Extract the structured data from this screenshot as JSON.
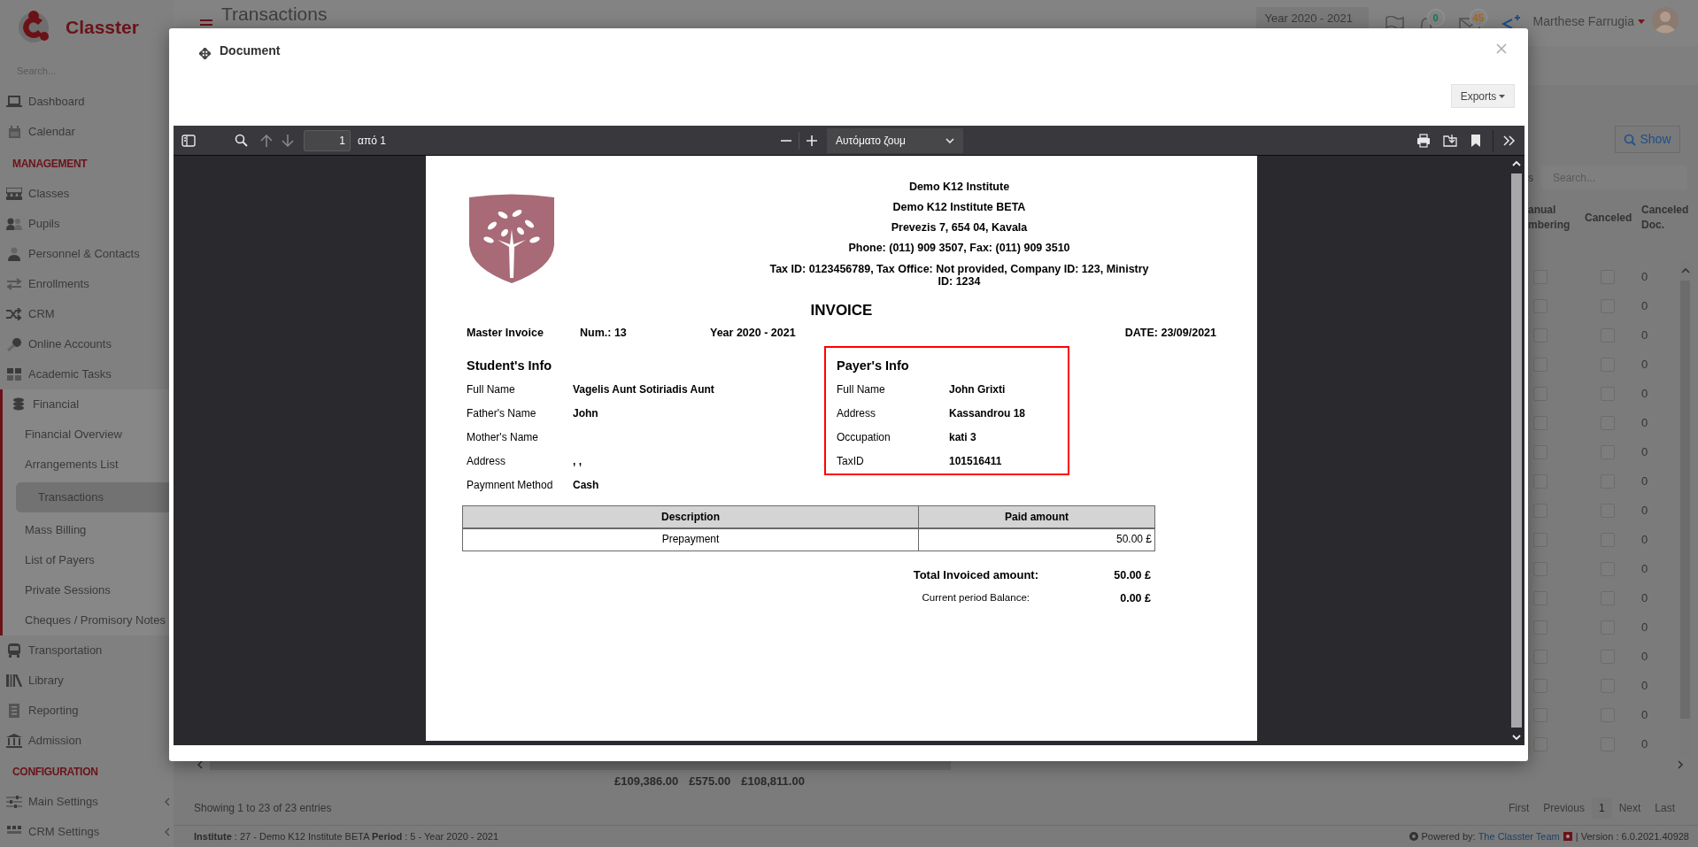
{
  "sidebar": {
    "logo": "Classter",
    "search_placeholder": "Search...",
    "items": [
      {
        "kind": "item",
        "label": "Dashboard",
        "selected": false
      },
      {
        "kind": "item",
        "label": "Calendar",
        "selected": false
      },
      {
        "kind": "section",
        "label": "MANAGEMENT"
      },
      {
        "kind": "item",
        "label": "Classes",
        "selected": false
      },
      {
        "kind": "item",
        "label": "Pupils",
        "selected": false
      },
      {
        "kind": "item",
        "label": "Personnel & Contacts",
        "selected": false
      },
      {
        "kind": "item",
        "label": "Enrollments",
        "selected": false
      },
      {
        "kind": "item",
        "label": "CRM",
        "selected": false
      },
      {
        "kind": "item",
        "label": "Online Accounts",
        "selected": false
      },
      {
        "kind": "item",
        "label": "Academic Tasks",
        "selected": false
      },
      {
        "kind": "item",
        "label": "Financial",
        "selected": false,
        "expanded": true,
        "children": [
          {
            "label": "Financial Overview",
            "selected": false
          },
          {
            "label": "Arrangements List",
            "selected": false
          },
          {
            "label": "Transactions",
            "selected": true
          },
          {
            "label": "Mass Billing",
            "selected": false
          },
          {
            "label": "List of Payers",
            "selected": false
          },
          {
            "label": "Private Sessions",
            "selected": false
          },
          {
            "label": "Cheques / Promisory Notes",
            "selected": false
          }
        ]
      },
      {
        "kind": "item",
        "label": "Transportation",
        "selected": false
      },
      {
        "kind": "item",
        "label": "Library",
        "selected": false
      },
      {
        "kind": "item",
        "label": "Reporting",
        "selected": false
      },
      {
        "kind": "item",
        "label": "Admission",
        "selected": false
      },
      {
        "kind": "section",
        "label": "CONFIGURATION"
      },
      {
        "kind": "item",
        "label": "Main Settings",
        "selected": false,
        "expanded": false
      },
      {
        "kind": "item",
        "label": "CRM Settings",
        "selected": false,
        "expanded": false
      }
    ]
  },
  "header": {
    "title": "Transactions",
    "year": "Year 2020 - 2021",
    "notifications": "0",
    "messages": "45",
    "user": "Marthese Farrugia"
  },
  "panel": {
    "show_button": "Show",
    "search_label": "s",
    "search_placeholder": "Search...",
    "columns": [
      "anual mbering",
      "Canceled",
      "Canceled Doc."
    ],
    "rows": [
      {
        "manual_numbering": false,
        "canceled": false,
        "canceled_doc": "0"
      },
      {
        "manual_numbering": false,
        "canceled": false,
        "canceled_doc": "0"
      },
      {
        "manual_numbering": false,
        "canceled": false,
        "canceled_doc": "0"
      },
      {
        "manual_numbering": false,
        "canceled": false,
        "canceled_doc": "0"
      },
      {
        "manual_numbering": false,
        "canceled": false,
        "canceled_doc": "0"
      },
      {
        "manual_numbering": false,
        "canceled": false,
        "canceled_doc": "0"
      },
      {
        "manual_numbering": false,
        "canceled": false,
        "canceled_doc": "0"
      },
      {
        "manual_numbering": false,
        "canceled": false,
        "canceled_doc": "0"
      },
      {
        "manual_numbering": false,
        "canceled": false,
        "canceled_doc": "0"
      },
      {
        "manual_numbering": false,
        "canceled": false,
        "canceled_doc": "0"
      },
      {
        "manual_numbering": false,
        "canceled": false,
        "canceled_doc": "0"
      },
      {
        "manual_numbering": false,
        "canceled": false,
        "canceled_doc": "0"
      },
      {
        "manual_numbering": false,
        "canceled": false,
        "canceled_doc": "0"
      },
      {
        "manual_numbering": false,
        "canceled": false,
        "canceled_doc": "0"
      },
      {
        "manual_numbering": false,
        "canceled": false,
        "canceled_doc": "0"
      },
      {
        "manual_numbering": false,
        "canceled": false,
        "canceled_doc": "0"
      },
      {
        "manual_numbering": false,
        "canceled": false,
        "canceled_doc": "0"
      }
    ],
    "totals": [
      "£109,386.00",
      "£575.00",
      "£108,811.00"
    ],
    "info": "Showing 1 to 23 of 23 entries",
    "pagination": [
      {
        "label": "First",
        "selected": false
      },
      {
        "label": "Previous",
        "selected": false
      },
      {
        "label": "1",
        "selected": true
      },
      {
        "label": "Next",
        "selected": false
      },
      {
        "label": "Last",
        "selected": false
      }
    ]
  },
  "status_bar": {
    "left": "**Institute** : 27 - Demo K12 Institute BETA **Period** : 5 - Year 2020 - 2021",
    "powered_by": "Powered by:",
    "team": "The Classter Team",
    "version": "| Version : 6.0.2021.40928"
  },
  "modal": {
    "title": "Document",
    "exports": "Exports",
    "viewer": {
      "page_number": "1",
      "page_count": "από 1",
      "zoom": "Αυτόματο ζουμ"
    },
    "invoice": {
      "institute_lines": [
        "Demo K12 Institute",
        "Demo K12 Institute BETA",
        "Prevezis 7, 654 04, Kavala",
        "Phone: (011) 909 3507, Fax: (011) 909 3510",
        "Tax ID: 0123456789, Tax Office: Not provided, Company ID: 123, Ministry ID: 1234"
      ],
      "title": "INVOICE",
      "meta": [
        "Master Invoice",
        "Num.: 13",
        "Year 2020 - 2021",
        "DATE: 23/09/2021"
      ],
      "student": {
        "heading": "Student's Info",
        "rows": [
          {
            "label": "Full Name",
            "value": "Vagelis Aunt Sotiriadis Aunt"
          },
          {
            "label": "Father's Name",
            "value": "John"
          },
          {
            "label": "Mother's Name"
          },
          {
            "label": "Address",
            "value": ", ,"
          },
          {
            "label": "Paymnent Method",
            "value": "Cash"
          }
        ]
      },
      "payer": {
        "heading": "Payer's Info",
        "highlighted": true,
        "rows": [
          {
            "label": "Full Name",
            "value": "John Grixti"
          },
          {
            "label": "Address",
            "value": "Kassandrou 18"
          },
          {
            "label": "Occupation",
            "value": "kati 3"
          },
          {
            "label": "TaxID",
            "value": "101516411"
          }
        ]
      },
      "table": {
        "columns": [
          "Description",
          "Paid amount"
        ],
        "rows": [
          [
            "Prepayment",
            "50.00 £"
          ]
        ]
      },
      "totals": [
        {
          "kind": "bold",
          "label": "Total Invoiced amount:",
          "value": "50.00 £"
        },
        {
          "kind": "plain",
          "label": "Current period Balance:",
          "value": "0.00 £"
        }
      ]
    }
  }
}
